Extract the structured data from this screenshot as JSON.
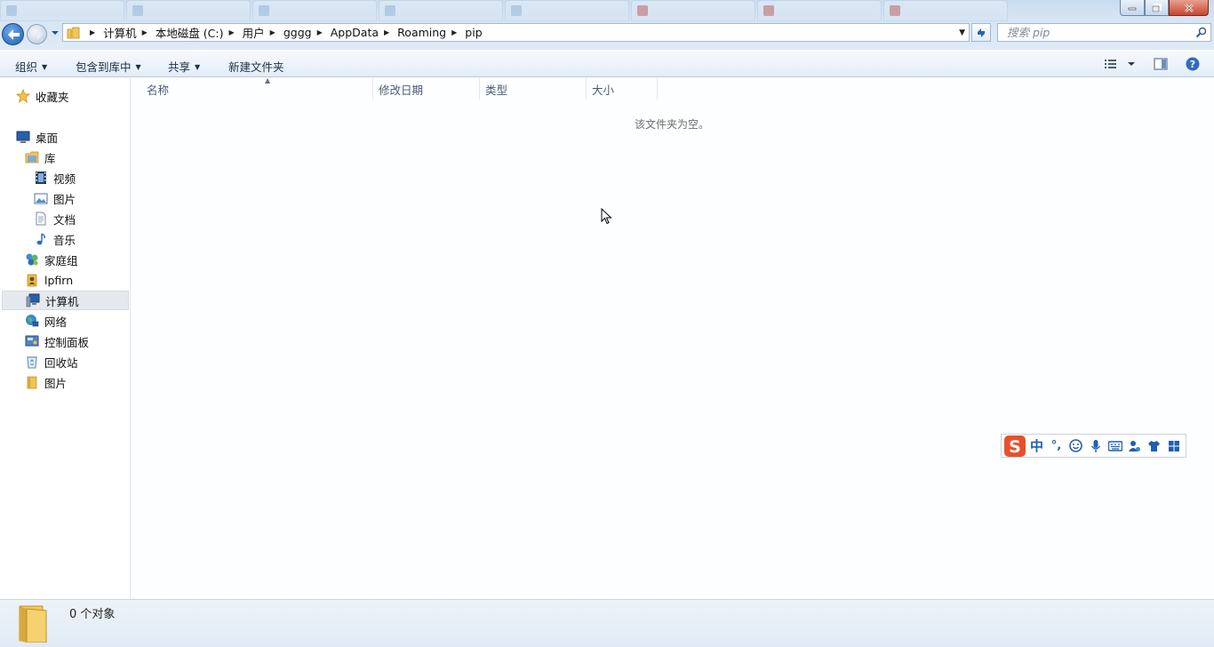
{
  "window": {
    "controls": {
      "minimize": "minimize",
      "maximize": "maximize",
      "close": "close"
    }
  },
  "address": {
    "breadcrumbs": [
      "计算机",
      "本地磁盘 (C:)",
      "用户",
      "gggg",
      "AppData",
      "Roaming",
      "pip"
    ]
  },
  "search": {
    "placeholder": "搜索 pip"
  },
  "toolbar": {
    "organize": "组织",
    "include_in_library": "包含到库中",
    "share": "共享",
    "new_folder": "新建文件夹"
  },
  "sidebar": {
    "favorites": "收藏夹",
    "desktop": "桌面",
    "library": "库",
    "videos": "视频",
    "pictures": "图片",
    "documents": "文档",
    "music": "音乐",
    "homegroup": "家庭组",
    "user": "lpfirn",
    "computer": "计算机",
    "network": "网络",
    "control_panel": "控制面板",
    "recycle_bin": "回收站",
    "pictures_folder": "图片"
  },
  "columns": {
    "name": "名称",
    "modified": "修改日期",
    "type": "类型",
    "size": "大小"
  },
  "content": {
    "empty_message": "该文件夹为空。"
  },
  "ime": {
    "mode": "中",
    "punct": "°,"
  },
  "status": {
    "count": "0 个对象"
  },
  "colors": {
    "accent": "#1d5fb3",
    "selection": "#e5e9ef",
    "ime_logo": "#e8502b"
  }
}
